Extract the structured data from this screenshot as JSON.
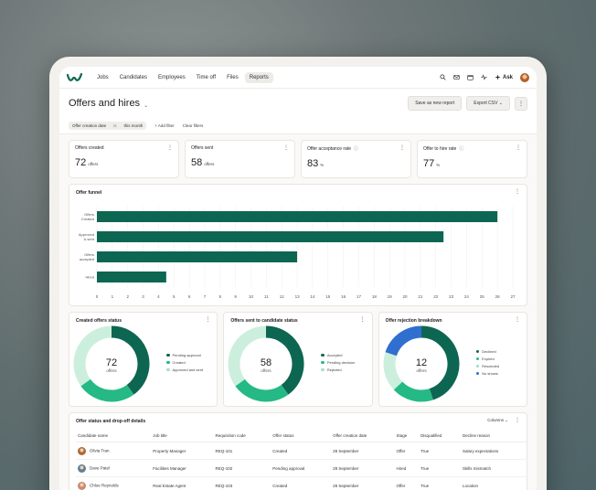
{
  "nav": {
    "items": [
      "Jobs",
      "Candidates",
      "Employees",
      "Time off",
      "Files",
      "Reports"
    ],
    "active_index": 5,
    "ask_label": "Ask",
    "icons": [
      "search-icon",
      "inbox-icon",
      "calendar-icon",
      "activity-icon",
      "sparkle-icon"
    ]
  },
  "header": {
    "title": "Offers and hires",
    "save_label": "Save as new report",
    "export_label": "Export CSV"
  },
  "filters": {
    "chip_field": "Offer creation date",
    "chip_op": "is",
    "chip_value": "this month",
    "add_label": "+ Add filter",
    "clear_label": "Clear filters"
  },
  "kpis": [
    {
      "label": "Offers created",
      "value": "72",
      "unit": "offers",
      "info": false
    },
    {
      "label": "Offers sent",
      "value": "58",
      "unit": "offers",
      "info": false
    },
    {
      "label": "Offer acceptance rate",
      "value": "83",
      "unit": "%",
      "info": true
    },
    {
      "label": "Offer to hire rate",
      "value": "77",
      "unit": "%",
      "info": true
    }
  ],
  "funnel": {
    "title": "Offer funnel",
    "categories": [
      "Offers Created",
      "Approved & sent",
      "Offers accepted",
      "Hired"
    ],
    "values": [
      26,
      22.5,
      13,
      4.5
    ],
    "ticks": [
      0,
      1,
      2,
      3,
      4,
      5,
      6,
      7,
      8,
      9,
      10,
      11,
      12,
      13,
      14,
      15,
      16,
      17,
      18,
      19,
      20,
      21,
      22,
      23,
      24,
      25,
      26,
      27
    ],
    "xmax": 27,
    "color": "#0d6652"
  },
  "donuts": [
    {
      "title": "Created offers status",
      "total": "72",
      "unit": "offers",
      "segments": [
        {
          "name": "Pending approval",
          "value": 40,
          "color": "#0d6652"
        },
        {
          "name": "Created",
          "value": 25,
          "color": "#25b986"
        },
        {
          "name": "Approved and sent",
          "value": 35,
          "color": "#ccefdd"
        }
      ]
    },
    {
      "title": "Offers sent to candidate status",
      "total": "58",
      "unit": "offers",
      "segments": [
        {
          "name": "Accepted",
          "value": 40,
          "color": "#0d6652"
        },
        {
          "name": "Pending decision",
          "value": 25,
          "color": "#25b986"
        },
        {
          "name": "Rejected",
          "value": 35,
          "color": "#ccefdd"
        }
      ]
    },
    {
      "title": "Offer rejection breakdown",
      "total": "12",
      "unit": "offers",
      "segments": [
        {
          "name": "Declined",
          "value": 45,
          "color": "#0d6652"
        },
        {
          "name": "Expired",
          "value": 18,
          "color": "#25b986"
        },
        {
          "name": "Rescinded",
          "value": 17,
          "color": "#ccefdd"
        },
        {
          "name": "No shows",
          "value": 20,
          "color": "#2f6fcf"
        }
      ]
    }
  ],
  "table": {
    "title": "Offer status and drop-off details",
    "columns_label": "Columns",
    "headers": [
      "Candidate name",
      "Job title",
      "Requisition code",
      "Offer status",
      "Offer creation date",
      "Stage",
      "Disqualified",
      "Decline reason"
    ],
    "rows": [
      [
        "Olivia Tran",
        "Property Manager",
        "REQ-101",
        "Created",
        "28 September",
        "Offer",
        "True",
        "Salary expectations"
      ],
      [
        "Dave Patel",
        "Facilities Manager",
        "REQ-102",
        "Pending approval",
        "28 September",
        "Hired",
        "True",
        "Skills mismatch"
      ],
      [
        "Chloe Reynolds",
        "Real Estate Agent",
        "REQ-103",
        "Created",
        "28 September",
        "Offer",
        "True",
        "Location"
      ]
    ],
    "avatar_colors": [
      "#a86a3d",
      "#5f7f95",
      "#c98a6d"
    ]
  }
}
